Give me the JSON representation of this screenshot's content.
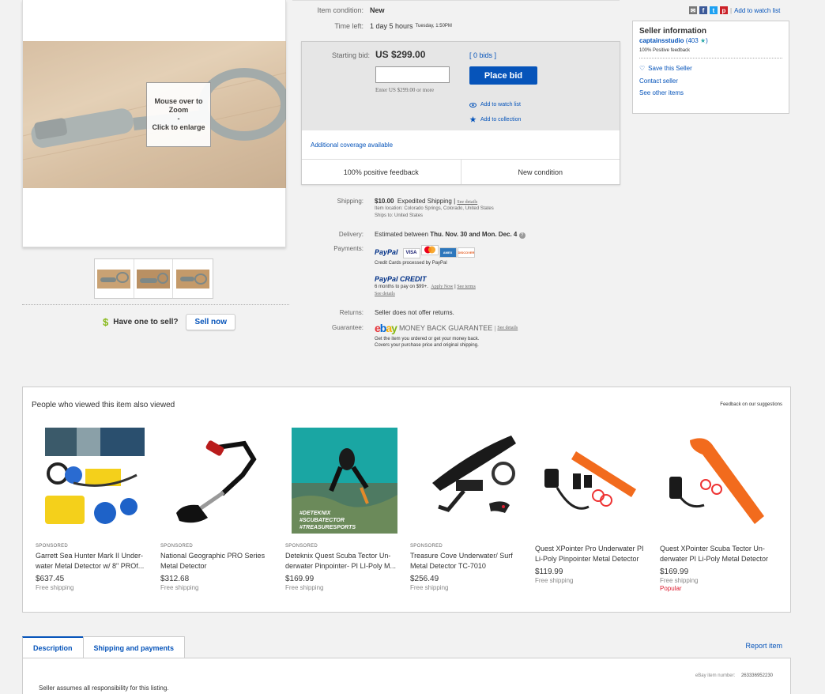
{
  "gallery": {
    "zoom_line1": "Mouse over to Zoom",
    "zoom_line2": "-",
    "zoom_line3": "Click to enlarge"
  },
  "sell": {
    "symbol": "$",
    "question": "Have one to sell?",
    "button": "Sell now"
  },
  "item": {
    "condition_label": "Item condition:",
    "condition_value": "New",
    "time_label": "Time left:",
    "time_value": "1 day 5 hours",
    "time_detail": "Tuesday, 1:50PM"
  },
  "bid": {
    "label": "Starting bid:",
    "price": "US $299.00",
    "bids_link": "[ 0 bids ]",
    "button": "Place bid",
    "hint": "Enter US $299.00 or more",
    "watch": "Add to watch list",
    "collection": "Add to collection",
    "coverage": "Additional coverage available",
    "feedback": "100% positive feedback",
    "condition": "New condition"
  },
  "share": {
    "watch_link": "Add to watch list",
    "separator": "|"
  },
  "seller": {
    "title": "Seller information",
    "name": "captainsstudio",
    "score": "(403",
    "score_end": ")",
    "positive": "100% Positive feedback",
    "save": "Save this Seller",
    "contact": "Contact seller",
    "other": "See other items"
  },
  "details": {
    "shipping_label": "Shipping:",
    "shipping_price": "$10.00",
    "shipping_type": "Expedited Shipping",
    "see_details": "See details",
    "location": "Item location:  Colorado Springs, Colorado, United States",
    "ships_to": "Ships to:   United States",
    "delivery_label": "Delivery:",
    "delivery_pre": "Estimated between",
    "delivery_dates": "Thu. Nov. 30 and Mon. Dec. 4",
    "payments_label": "Payments:",
    "paypal": "PayPal",
    "cards_note": "Credit Cards processed by PayPal",
    "credit_title": "PayPal CREDIT",
    "credit_note": "6 months to pay on $99+.",
    "apply_now": "Apply Now",
    "see_terms": "See terms",
    "see_details2": "See details",
    "returns_label": "Returns:",
    "returns_value": "Seller does not offer returns.",
    "guarantee_label": "Guarantee:",
    "mbg": "MONEY BACK GUARANTEE",
    "see_details3": "See details",
    "guarantee_line1": "Get the item you ordered or get your money back.",
    "guarantee_line2": "Covers your purchase price and original shipping."
  },
  "carousel": {
    "title": "People who viewed this item also viewed",
    "feedback": "Feedback on our suggestions",
    "items": [
      {
        "sponsored": "SPONSORED",
        "name": "Garrett Sea Hunter Mark II Under-water Metal Detector w/ 8\" PROf...",
        "price": "$637.45",
        "shipping": "Free shipping"
      },
      {
        "sponsored": "SPONSORED",
        "name": "National Geographic PRO Series Metal Detector",
        "price": "$312.68",
        "shipping": "Free shipping"
      },
      {
        "sponsored": "SPONSORED",
        "name": "Deteknix Quest Scuba Tector Un-derwater Pinpointer- PI LI-Poly M...",
        "price": "$169.99",
        "shipping": "Free shipping",
        "overlay1": "#DETEKNIX",
        "overlay2": "#SCUBATECTOR",
        "overlay3": "#TREASURESPORTS"
      },
      {
        "sponsored": "SPONSORED",
        "name": "Treasure Cove Underwater/ Surf Metal Detector TC-7010",
        "price": "$256.49",
        "shipping": "Free shipping"
      },
      {
        "sponsored": "",
        "name": "Quest XPointer Pro Underwater PI Li-Poly Pinpointer Metal Detector",
        "price": "$119.99",
        "shipping": "Free shipping"
      },
      {
        "sponsored": "",
        "name": "Quest XPointer Scuba Tector Un-derwater PI Li-Poly Metal Detector",
        "price": "$169.99",
        "shipping": "Free shipping",
        "badge": "Popular"
      }
    ]
  },
  "tabs": {
    "description": "Description",
    "shipping": "Shipping and payments",
    "report": "Report item"
  },
  "description": {
    "number_label": "eBay item number:",
    "number": "263336952230",
    "assume": "Seller assumes all responsibility for this listing."
  },
  "colors": {
    "link": "#0654ba",
    "paypal_dark": "#003087",
    "popular": "#dd1e31"
  }
}
